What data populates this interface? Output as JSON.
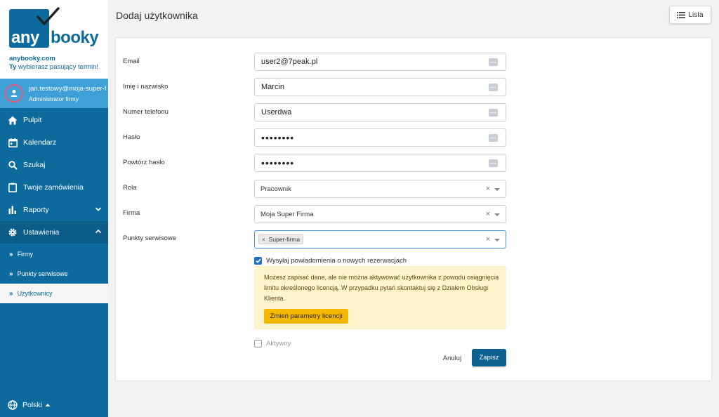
{
  "brand": {
    "logo_left": "any",
    "logo_right": "booky",
    "site": "anybooky.com",
    "tagline_bold": "Ty",
    "tagline_rest": " wybierasz pasujący termin!"
  },
  "user": {
    "email": "jan.testowy@moja-super-firma.pl",
    "role": "Administrator firmy"
  },
  "nav": {
    "pulpit": "Pulpit",
    "kalendarz": "Kalendarz",
    "szukaj": "Szukaj",
    "zamowienia": "Twoje zamówienia",
    "raporty": "Raporty",
    "ustawienia": "Ustawienia",
    "sub": {
      "firmy": "Firmy",
      "punkty": "Punkty serwisowe",
      "uzytkownicy": "Użytkownicy"
    }
  },
  "language": "Polski",
  "page": {
    "title": "Dodaj użytkownika",
    "list_button": "Lista"
  },
  "form": {
    "email": {
      "label": "Email",
      "value": "user2@7peak.pl"
    },
    "name": {
      "label": "Imię i nazwisko",
      "value": "Marcin"
    },
    "phone": {
      "label": "Numer telefonu",
      "value": "Userdwa"
    },
    "password": {
      "label": "Hasło",
      "value": "••••••••"
    },
    "password_repeat": {
      "label": "Powtórz hasło",
      "value": "••••••••"
    },
    "role": {
      "label": "Rola",
      "value": "Pracownik"
    },
    "company": {
      "label": "Firma",
      "value": "Moja Super Firma"
    },
    "service_points": {
      "label": "Punkty serwisowe",
      "tags": [
        "Super-firma"
      ]
    },
    "notify": {
      "label": "Wysyłaj powiadomienia o nowych rezerwacjach",
      "checked": true
    },
    "active": {
      "label": "Aktywny",
      "checked": false
    }
  },
  "warning": {
    "text": "Możesz zapisać dane, ale nie można aktywować użytkownika z powodu osiągnięcia limitu określonego licencją. W przypadku pytań skontaktuj się z Działem Obsługi Klienta.",
    "button": "Zmień parametry licencji"
  },
  "actions": {
    "cancel": "Anuluj",
    "save": "Zapisz"
  },
  "colors": {
    "sidebar": "#0d6a9c",
    "user_box": "#3ea0d6",
    "primary_button": "#0d5f8f",
    "warning_bg": "#fff3cc",
    "warning_button": "#f5b800"
  }
}
